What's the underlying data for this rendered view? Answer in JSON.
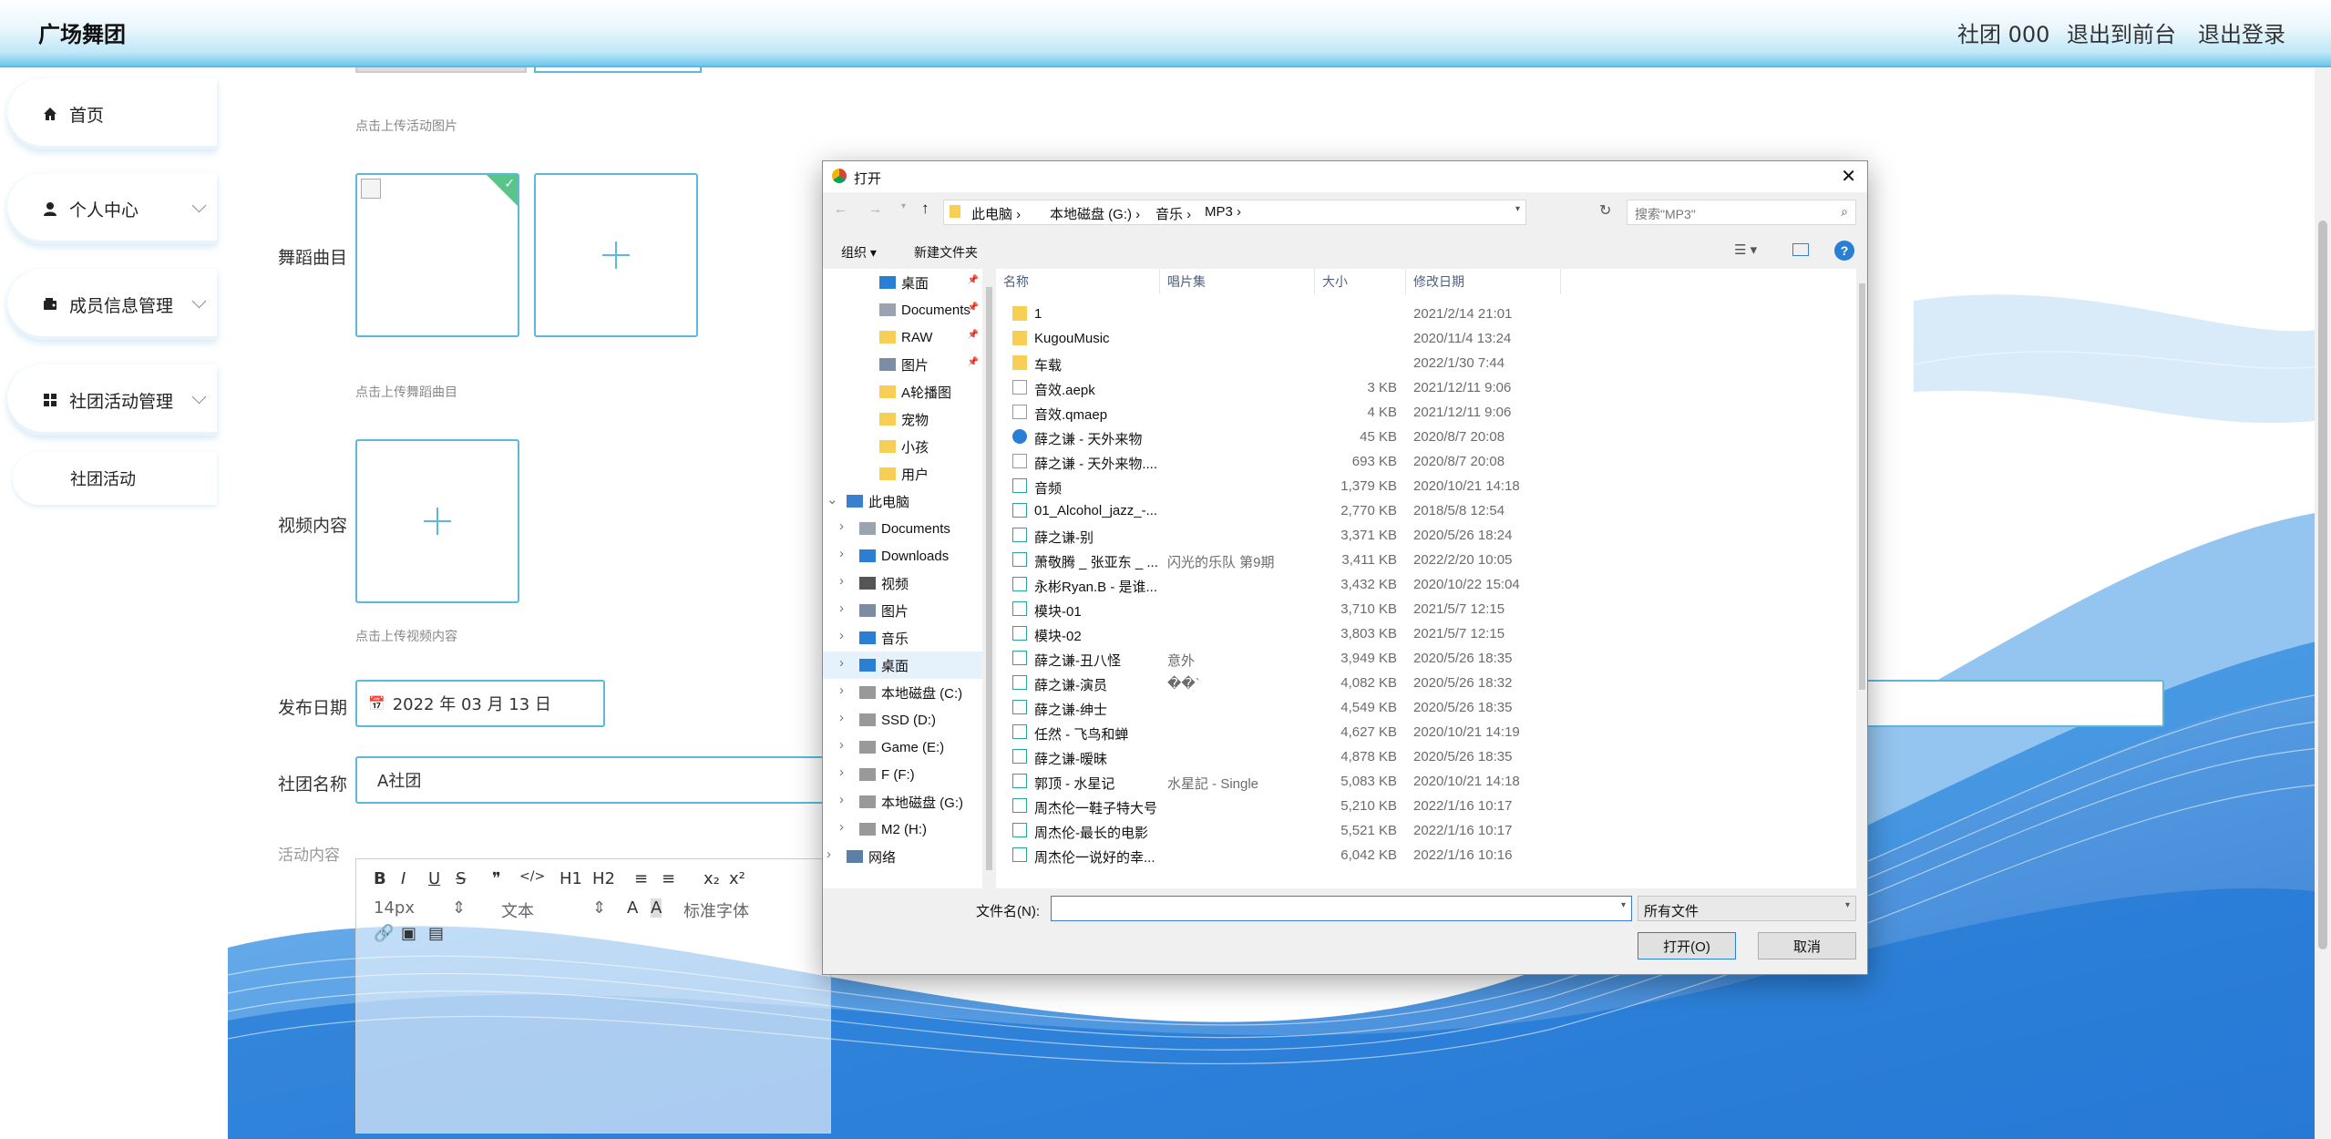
{
  "header": {
    "brand": "广场舞团",
    "links": [
      "社团 000",
      "退出到前台",
      "退出登录"
    ]
  },
  "sidebar": {
    "items": [
      {
        "label": "首页",
        "icon": "home-icon",
        "has_children": false
      },
      {
        "label": "个人中心",
        "icon": "user-icon",
        "has_children": true
      },
      {
        "label": "成员信息管理",
        "icon": "wallet-icon",
        "has_children": true
      },
      {
        "label": "社团活动管理",
        "icon": "grid-icon",
        "has_children": true
      }
    ],
    "sub_item": "社团活动"
  },
  "form": {
    "hint_activity_image": "点击上传活动图片",
    "dance_music_label": "舞蹈曲目",
    "hint_dance_music": "点击上传舞蹈曲目",
    "video_label": "视频内容",
    "hint_video": "点击上传视频内容",
    "publish_date_label": "发布日期",
    "publish_date_value": "2022 年 03 月 13 日",
    "club_name_label": "社团名称",
    "club_name_value": "A社团",
    "activity_content_label": "活动内容",
    "editor_toolbar": {
      "row1": [
        "B",
        "I",
        "U",
        "S",
        "❞",
        "</>",
        "H1",
        "H2",
        "≡",
        "≡",
        "x₂",
        "x²"
      ],
      "font_size": "14px",
      "text_type": "文本",
      "font_family": "标准字体"
    }
  },
  "dialog": {
    "title": "打开",
    "breadcrumb": [
      "此电脑",
      "本地磁盘 (G:)",
      "音乐",
      "MP3"
    ],
    "search_placeholder": "搜索\"MP3\"",
    "toolbar": {
      "organize": "组织 ▾",
      "new_folder": "新建文件夹"
    },
    "nav_items": [
      {
        "label": "桌面",
        "kind": "desktop",
        "pinned": true,
        "level": 0
      },
      {
        "label": "Documents",
        "kind": "docs",
        "pinned": true,
        "level": 0
      },
      {
        "label": "RAW",
        "kind": "folder",
        "pinned": true,
        "level": 0
      },
      {
        "label": "图片",
        "kind": "pictures",
        "pinned": true,
        "level": 0
      },
      {
        "label": "A轮播图",
        "kind": "folder",
        "pinned": false,
        "level": 0
      },
      {
        "label": "宠物",
        "kind": "folder",
        "pinned": false,
        "level": 0
      },
      {
        "label": "小孩",
        "kind": "folder",
        "pinned": false,
        "level": 0
      },
      {
        "label": "用户",
        "kind": "folder",
        "pinned": false,
        "level": 0
      },
      {
        "label": "此电脑",
        "kind": "pc",
        "pinned": false,
        "level": -1
      },
      {
        "label": "Documents",
        "kind": "docs",
        "pinned": false,
        "level": 1
      },
      {
        "label": "Downloads",
        "kind": "download",
        "pinned": false,
        "level": 1
      },
      {
        "label": "视频",
        "kind": "video",
        "pinned": false,
        "level": 1
      },
      {
        "label": "图片",
        "kind": "pictures",
        "pinned": false,
        "level": 1
      },
      {
        "label": "音乐",
        "kind": "music",
        "pinned": false,
        "level": 1
      },
      {
        "label": "桌面",
        "kind": "desktop",
        "pinned": false,
        "level": 1
      },
      {
        "label": "本地磁盘 (C:)",
        "kind": "drive",
        "pinned": false,
        "level": 1
      },
      {
        "label": "SSD (D:)",
        "kind": "drive",
        "pinned": false,
        "level": 1
      },
      {
        "label": "Game (E:)",
        "kind": "drive",
        "pinned": false,
        "level": 1
      },
      {
        "label": "F (F:)",
        "kind": "drive",
        "pinned": false,
        "level": 1
      },
      {
        "label": "本地磁盘 (G:)",
        "kind": "drive",
        "pinned": false,
        "level": 1
      },
      {
        "label": "M2 (H:)",
        "kind": "drive",
        "pinned": false,
        "level": 1
      },
      {
        "label": "网络",
        "kind": "network",
        "pinned": false,
        "level": -1
      }
    ],
    "columns": [
      "名称",
      "唱片集",
      "大小",
      "修改日期"
    ],
    "files": [
      {
        "name": "1",
        "album": "",
        "size": "",
        "date": "2021/2/14 21:01",
        "type": "folder"
      },
      {
        "name": "KugouMusic",
        "album": "",
        "size": "",
        "date": "2020/11/4 13:24",
        "type": "folder"
      },
      {
        "name": "车载",
        "album": "",
        "size": "",
        "date": "2022/1/30 7:44",
        "type": "folder"
      },
      {
        "name": "音效.aepk",
        "album": "",
        "size": "3 KB",
        "date": "2021/12/11 9:06",
        "type": "file"
      },
      {
        "name": "音效.qmaep",
        "album": "",
        "size": "4 KB",
        "date": "2021/12/11 9:06",
        "type": "file"
      },
      {
        "name": "薛之谦 - 天外来物",
        "album": "",
        "size": "45 KB",
        "date": "2020/8/7 20:08",
        "type": "app"
      },
      {
        "name": "薛之谦 - 天外来物....",
        "album": "",
        "size": "693 KB",
        "date": "2020/8/7 20:08",
        "type": "file"
      },
      {
        "name": "音频",
        "album": "",
        "size": "1,379 KB",
        "date": "2020/10/21 14:18",
        "type": "audio"
      },
      {
        "name": "01_Alcohol_jazz_-...",
        "album": "",
        "size": "2,770 KB",
        "date": "2018/5/8 12:54",
        "type": "audio"
      },
      {
        "name": "薛之谦-别",
        "album": "",
        "size": "3,371 KB",
        "date": "2020/5/26 18:24",
        "type": "audio"
      },
      {
        "name": "萧敬腾 _ 张亚东 _ ...",
        "album": "闪光的乐队 第9期",
        "size": "3,411 KB",
        "date": "2022/2/20 10:05",
        "type": "audio"
      },
      {
        "name": "永彬Ryan.B - 是谁...",
        "album": "",
        "size": "3,432 KB",
        "date": "2020/10/22 15:04",
        "type": "audio"
      },
      {
        "name": "模块-01",
        "album": "",
        "size": "3,710 KB",
        "date": "2021/5/7 12:15",
        "type": "audio"
      },
      {
        "name": "模块-02",
        "album": "",
        "size": "3,803 KB",
        "date": "2021/5/7 12:15",
        "type": "audio"
      },
      {
        "name": "薛之谦-丑八怪",
        "album": "意外",
        "size": "3,949 KB",
        "date": "2020/5/26 18:35",
        "type": "audio"
      },
      {
        "name": "薛之谦-演员",
        "album": "��`",
        "size": "4,082 KB",
        "date": "2020/5/26 18:32",
        "type": "audio"
      },
      {
        "name": "薛之谦-绅士",
        "album": "",
        "size": "4,549 KB",
        "date": "2020/5/26 18:35",
        "type": "audio"
      },
      {
        "name": "任然 - 飞鸟和蝉",
        "album": "",
        "size": "4,627 KB",
        "date": "2020/10/21 14:19",
        "type": "audio"
      },
      {
        "name": "薛之谦-暧昧",
        "album": "",
        "size": "4,878 KB",
        "date": "2020/5/26 18:35",
        "type": "audio"
      },
      {
        "name": "郭顶 - 水星记",
        "album": "水星記 - Single",
        "size": "5,083 KB",
        "date": "2020/10/21 14:18",
        "type": "audio"
      },
      {
        "name": "周杰伦一鞋子特大号",
        "album": "",
        "size": "5,210 KB",
        "date": "2022/1/16 10:17",
        "type": "audio"
      },
      {
        "name": "周杰伦-最长的电影",
        "album": "",
        "size": "5,521 KB",
        "date": "2022/1/16 10:17",
        "type": "audio"
      },
      {
        "name": "周杰伦一说好的幸...",
        "album": "",
        "size": "6,042 KB",
        "date": "2022/1/16 10:16",
        "type": "audio"
      }
    ],
    "filename_label": "文件名(N):",
    "filename_value": "",
    "filetype": "所有文件",
    "open_button": "打开(O)",
    "cancel_button": "取消"
  },
  "colors": {
    "accent": "#5cb8dc",
    "topbar_bottom": "#55bde6",
    "wave": "#2a8ee0"
  }
}
